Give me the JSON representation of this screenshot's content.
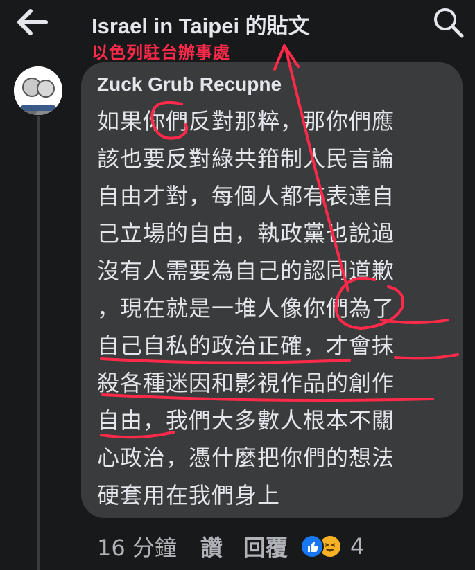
{
  "header": {
    "title": "Israel in Taipei 的貼文",
    "back_icon": "arrow-left-icon",
    "search_icon": "search-icon"
  },
  "annotation": {
    "note": "以色列駐台辦事處",
    "color": "#ff2a4a"
  },
  "comment": {
    "author": "Zuck Grub Recupne",
    "lines": [
      "如果你們反對那粹，那你們應",
      "該也要反對綠共箝制人民言論",
      "自由才對，每個人都有表達自",
      "己立場的自由，執政黨也說過",
      "沒有人需要為自己的認同道歉",
      "，現在就是一堆人像你們為了",
      "自己自私的政治正確，才會抹",
      "殺各種迷因和影視作品的創作",
      "自由，我們大多數人根本不關",
      "心政治，憑什麼把你們的想法",
      "硬套用在我們身上"
    ],
    "time": "16 分鐘",
    "like_label": "讚",
    "reply_label": "回覆",
    "reaction_count": "4",
    "reactions": [
      "like-icon",
      "haha-icon"
    ]
  },
  "colors": {
    "background": "#18191a",
    "bubble": "#3a3b3c",
    "text": "#e4e6eb",
    "secondary_text": "#b0b3b8",
    "like_blue": "#1877f2",
    "haha_yellow": "#f7b125"
  }
}
